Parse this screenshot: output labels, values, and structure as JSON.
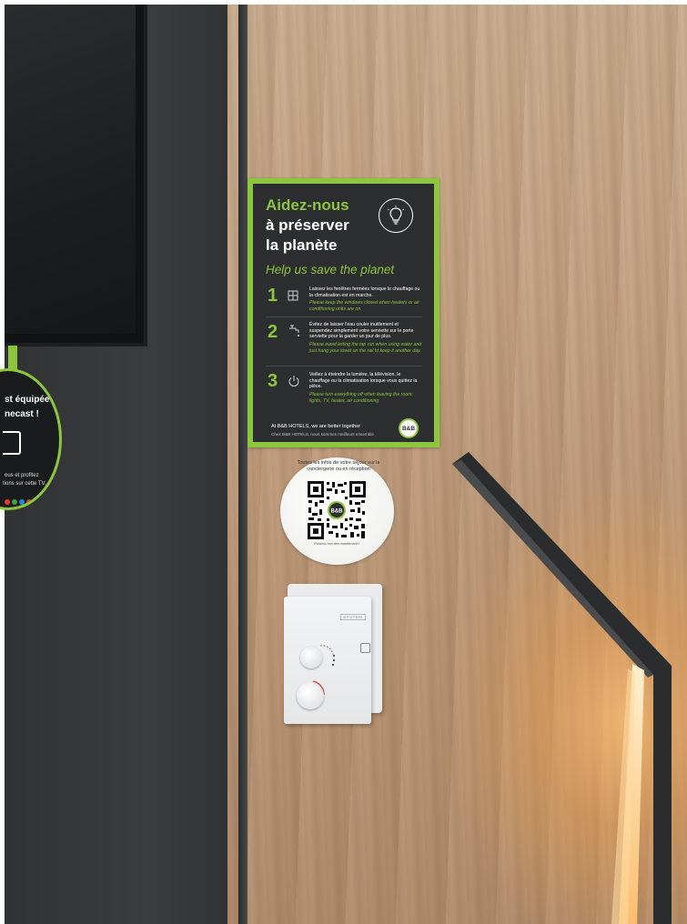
{
  "poster": {
    "title_line1": "Aidez-nous",
    "title_line2": "à préserver",
    "title_line3": "la planète",
    "subtitle": "Help us save the planet",
    "items": [
      {
        "number": "1",
        "fr": "Laissez les fenêtres fermées lorsque le chauffage ou la climatisation est en marche.",
        "en": "Please keep the windows closed when heaters or air conditioning units are on."
      },
      {
        "number": "2",
        "fr": "Évitez de laisser l'eau couler inutilement et suspendez simplement votre serviette sur le porte serviette pour la garder un jour de plus.",
        "en": "Please avoid letting the tap run when using water and just hang your towel on the rail to keep it another day."
      },
      {
        "number": "3",
        "fr": "Veillez à éteindre la lumière, la télévision, le chauffage ou la climatisation lorsque vous quittez la pièce.",
        "en": "Please turn everything off when leaving the room: lights, TV, heater, air conditioning"
      }
    ],
    "footer_en": "At B&B HOTELS, we are better together",
    "footer_fr": "Chez B&B HOTELS, nous sommes meilleurs ensemble",
    "logo": "B&B"
  },
  "chromecast_sticker": {
    "line1": "st équipée",
    "line2": "necast !",
    "line3": "ous et profitez",
    "line4": "tions sur cette TV."
  },
  "qr_sticker": {
    "arc_text": "Toutes les infos de votre séjour sur la conciergerie ou en réception",
    "center_logo": "B&B",
    "bottom_text": "Flashez-moi dès maintenant !"
  },
  "thermostat": {
    "brand": "SYSTEM"
  },
  "colors": {
    "accent_green": "#8cc63f",
    "poster_dark": "#2c2e2f",
    "wood": "#c4a386",
    "led": "#ffb45a"
  }
}
